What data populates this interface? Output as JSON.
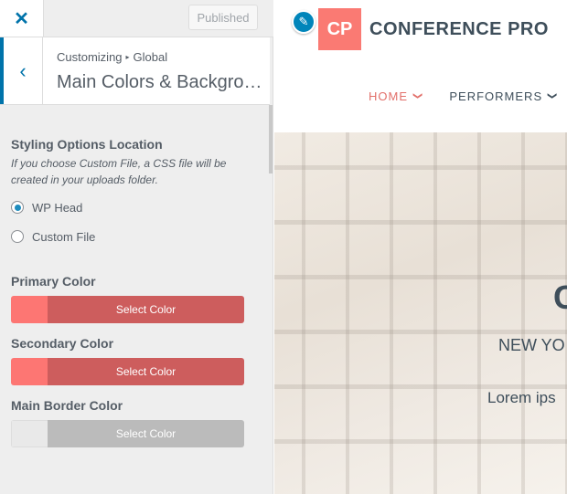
{
  "topbar": {
    "close_icon": "close-x-icon",
    "close_glyph": "✕",
    "publish_label": "Published"
  },
  "section": {
    "back_glyph": "‹",
    "breadcrumb_root": "Customizing",
    "breadcrumb_sep": "▸",
    "breadcrumb_current": "Global",
    "title": "Main Colors & Backgrounds"
  },
  "styling": {
    "label": "Styling Options Location",
    "description": "If you choose Custom File, a CSS file will be created in your uploads folder.",
    "options": [
      {
        "label": "WP Head",
        "selected": true
      },
      {
        "label": "Custom File",
        "selected": false
      }
    ]
  },
  "colors": [
    {
      "label": "Primary Color",
      "button_label": "Select Color",
      "swatch": "#fd7673",
      "button_bg": "#cd5d5d"
    },
    {
      "label": "Secondary Color",
      "button_label": "Select Color",
      "swatch": "#fd7673",
      "button_bg": "#cd5d5d"
    },
    {
      "label": "Main Border Color",
      "button_label": "Select Color",
      "swatch": "#e9e9e9",
      "button_bg": "#bbbbbb"
    }
  ],
  "preview": {
    "logo_initials": "CP",
    "logo_text": "CONFERENCE PRO",
    "edit_glyph": "✎",
    "nav": [
      {
        "label": "HOME",
        "active": true,
        "color": "#e2706a"
      },
      {
        "label": "PERFORMERS",
        "active": false,
        "color": "#3e4e5a"
      }
    ],
    "nav_chevron": "❯",
    "hero_heading_partial": "C",
    "hero_sub_partial": "NEW YO",
    "hero_text_partial": "Lorem ips"
  },
  "accent": "#0073aa"
}
